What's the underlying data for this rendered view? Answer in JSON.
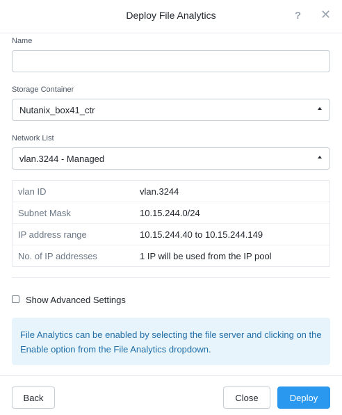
{
  "dialog": {
    "title": "Deploy File Analytics",
    "help_glyph": "?",
    "close_glyph": "✕"
  },
  "form": {
    "name": {
      "label": "Name",
      "value": "",
      "placeholder": ""
    },
    "storage_container": {
      "label": "Storage Container",
      "value": "Nutanix_box41_ctr"
    },
    "network_list": {
      "label": "Network List",
      "value": "vlan.3244 - Managed"
    }
  },
  "network_info": {
    "rows": [
      {
        "key": "vlan ID",
        "value": "vlan.3244"
      },
      {
        "key": "Subnet Mask",
        "value": "10.15.244.0/24"
      },
      {
        "key": "IP address range",
        "value": "10.15.244.40 to 10.15.244.149"
      },
      {
        "key": "No. of IP addresses",
        "value": "1 IP will be used from the IP pool"
      }
    ]
  },
  "advanced": {
    "label": "Show Advanced Settings",
    "checked": false
  },
  "info_message": "File Analytics can be enabled by selecting the file server and clicking on the Enable option from the File Analytics dropdown.",
  "footer": {
    "back": "Back",
    "close": "Close",
    "deploy": "Deploy"
  },
  "colors": {
    "primary": "#2b98f0",
    "info_bg": "#e8f4fc",
    "info_text": "#1f6ea8"
  }
}
